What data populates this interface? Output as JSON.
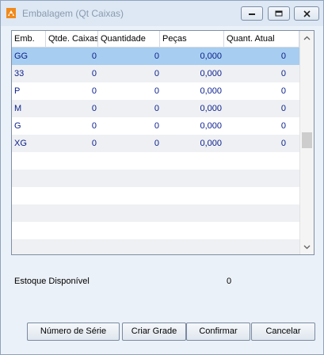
{
  "window": {
    "title": "Embalagem (Qt Caixas)"
  },
  "grid": {
    "columns": [
      "Emb.",
      "Qtde. Caixas",
      "Quantidade",
      "Peças",
      "Quant. Atual"
    ],
    "rows": [
      {
        "emb": "GG",
        "qtde_caixas": "0",
        "quantidade": "0",
        "pecas": "0,000",
        "quant_atual": "0"
      },
      {
        "emb": "33",
        "qtde_caixas": "0",
        "quantidade": "0",
        "pecas": "0,000",
        "quant_atual": "0"
      },
      {
        "emb": "P",
        "qtde_caixas": "0",
        "quantidade": "0",
        "pecas": "0,000",
        "quant_atual": "0"
      },
      {
        "emb": "M",
        "qtde_caixas": "0",
        "quantidade": "0",
        "pecas": "0,000",
        "quant_atual": "0"
      },
      {
        "emb": "G",
        "qtde_caixas": "0",
        "quantidade": "0",
        "pecas": "0,000",
        "quant_atual": "0"
      },
      {
        "emb": "XG",
        "qtde_caixas": "0",
        "quantidade": "0",
        "pecas": "0,000",
        "quant_atual": "0"
      }
    ],
    "selected_row": 0
  },
  "estoque": {
    "label": "Estoque Disponível",
    "value": "0"
  },
  "buttons": {
    "numero_serie": "Número de Série",
    "criar_grade": "Criar Grade",
    "confirmar": "Confirmar",
    "cancelar": "Cancelar"
  },
  "colors": {
    "selection": "#a7cdf0",
    "cell_text": "#0a1e8c",
    "title_text": "#8a9aae"
  }
}
